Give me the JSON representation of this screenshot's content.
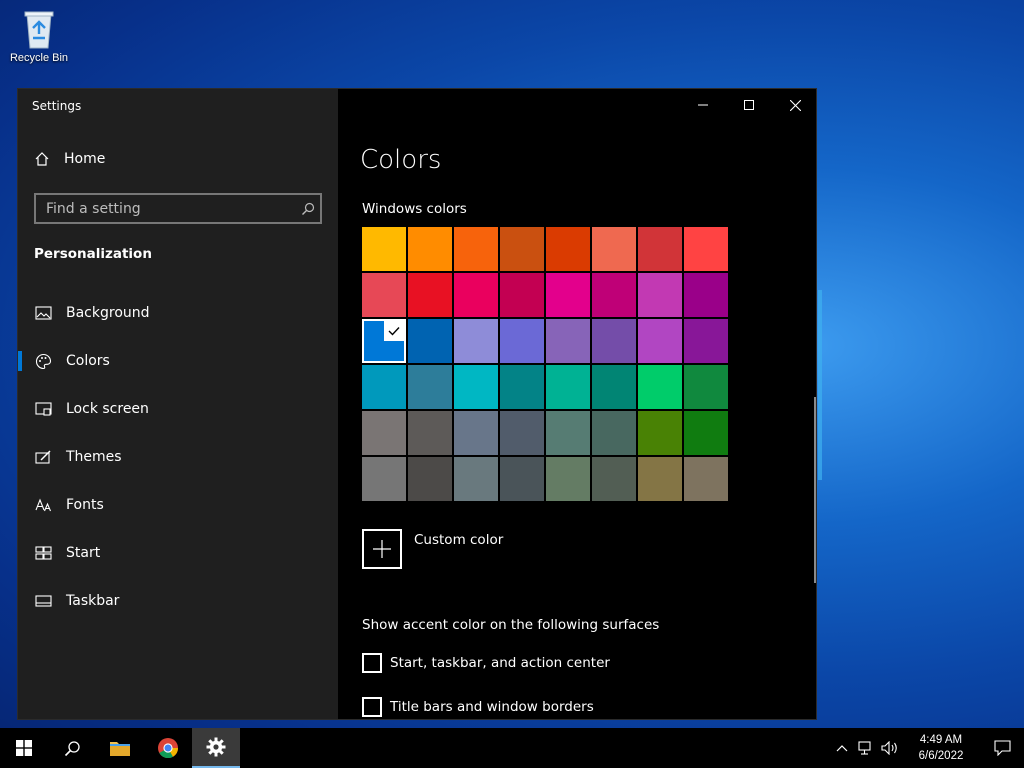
{
  "desktop": {
    "recycle_bin_label": "Recycle Bin"
  },
  "window": {
    "title": "Settings"
  },
  "sidebar": {
    "home_label": "Home",
    "search_placeholder": "Find a setting",
    "section_title": "Personalization",
    "items": [
      {
        "label": "Background",
        "icon": "image-icon",
        "active": false
      },
      {
        "label": "Colors",
        "icon": "palette-icon",
        "active": true
      },
      {
        "label": "Lock screen",
        "icon": "lock-screen-icon",
        "active": false
      },
      {
        "label": "Themes",
        "icon": "themes-icon",
        "active": false
      },
      {
        "label": "Fonts",
        "icon": "fonts-icon",
        "active": false
      },
      {
        "label": "Start",
        "icon": "start-icon",
        "active": false
      },
      {
        "label": "Taskbar",
        "icon": "taskbar-icon",
        "active": false
      }
    ]
  },
  "main": {
    "title": "Colors",
    "windows_colors_label": "Windows colors",
    "swatches": [
      [
        "#FFB900",
        "#FF8C00",
        "#F7630C",
        "#CA5010",
        "#DA3B01",
        "#EF6950",
        "#D13438",
        "#FF4343"
      ],
      [
        "#E74856",
        "#E81123",
        "#EA005E",
        "#C30052",
        "#E3008C",
        "#BF0077",
        "#C239B3",
        "#9A0089"
      ],
      [
        "#0078D7",
        "#0063B1",
        "#8E8CD8",
        "#6B69D6",
        "#8764B8",
        "#744DA9",
        "#B146C2",
        "#881798"
      ],
      [
        "#0099BC",
        "#2D7D9A",
        "#00B7C3",
        "#038387",
        "#00B294",
        "#018574",
        "#00CC6A",
        "#10893E"
      ],
      [
        "#7A7574",
        "#5D5A58",
        "#68768A",
        "#515C6B",
        "#567C73",
        "#486860",
        "#498205",
        "#107C10"
      ],
      [
        "#767676",
        "#4C4A48",
        "#69797E",
        "#4A5459",
        "#647C64",
        "#525E54",
        "#847545",
        "#7E735F"
      ]
    ],
    "selected_swatch": {
      "row": 2,
      "col": 0
    },
    "custom_color_label": "Custom color",
    "accent_title": "Show accent color on the following surfaces",
    "checkboxes": [
      {
        "label": "Start, taskbar, and action center",
        "checked": false
      },
      {
        "label": "Title bars and window borders",
        "checked": false
      }
    ]
  },
  "taskbar": {
    "time": "4:49 AM",
    "date": "6/6/2022"
  },
  "colors": {
    "accent": "#0078d7",
    "sidebar_bg": "#1f1f1f",
    "main_bg": "#000000"
  }
}
